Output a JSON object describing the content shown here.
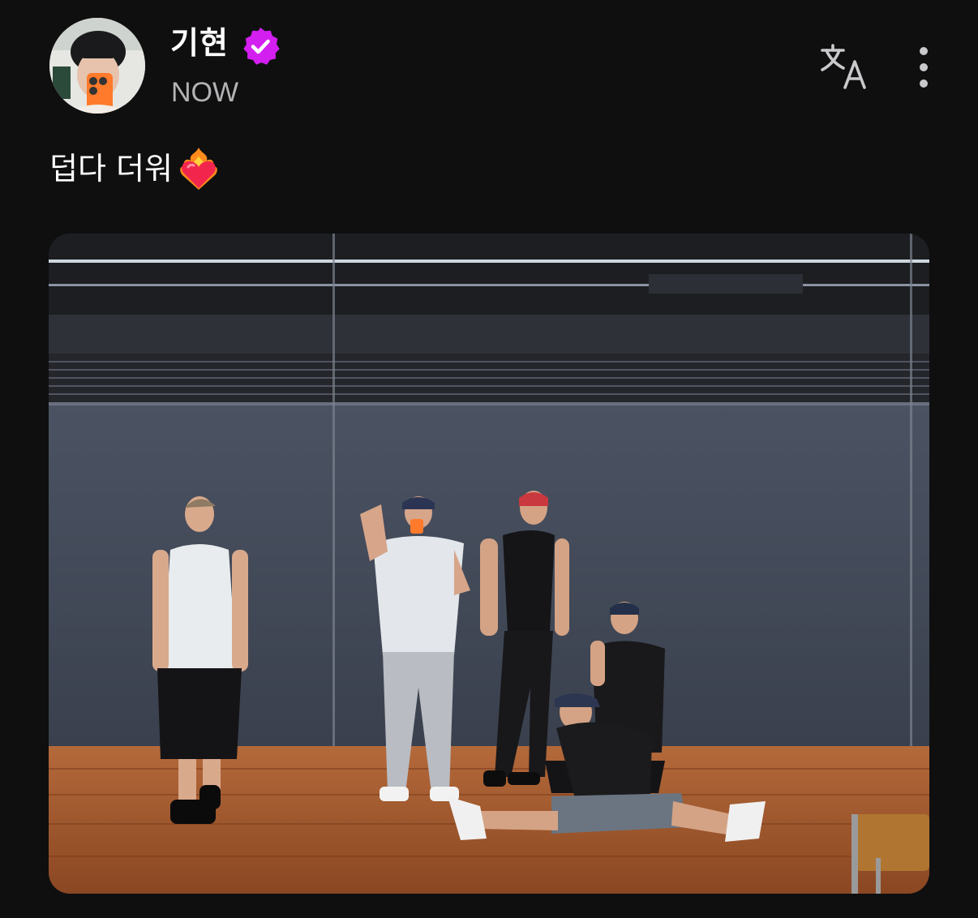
{
  "author": {
    "name": "기현",
    "verified_icon": "verified-badge-icon",
    "timestamp": "NOW"
  },
  "header_actions": {
    "translate_icon": "translate-icon",
    "more_icon": "more-vertical-icon"
  },
  "post": {
    "caption": "덥다 더워",
    "caption_emoji": "heart-on-fire-icon",
    "photo_alt": "dance-practice-room-photo"
  },
  "colors": {
    "background": "#0f0f10",
    "verified_badge": "#d31ff0",
    "timestamp": "#b3b3b6",
    "icon": "#c9c9cc"
  }
}
